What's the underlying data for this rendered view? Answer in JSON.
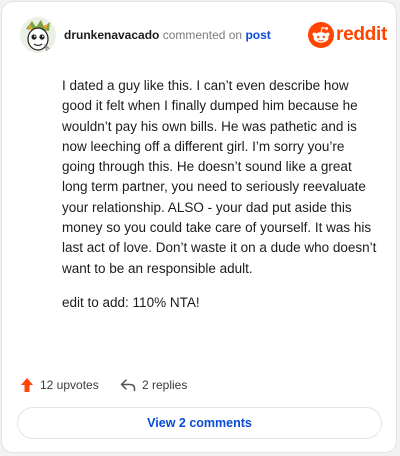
{
  "comment": {
    "username": "drunkenavacado",
    "commented_on": "commented on",
    "post_link": "post",
    "paragraphs": [
      "I dated a guy like this. I can’t even describe how good it felt when I finally dumped him because he wouldn’t pay his own bills. He was pathetic and is now leeching off a different girl. I’m sorry you’re going through this. He doesn’t sound like a great long term partner, you need to seriously reevaluate your relationship. ALSO - your dad put aside this money so you could take care of yourself. It was his last act of love. Don’t waste it on a dude who doesn’t want to be an responsible adult.",
      "edit to add: 110% NTA!"
    ]
  },
  "brand": {
    "name": "reddit",
    "color": "#ff4500"
  },
  "actions": {
    "upvotes_label": "12 upvotes",
    "replies_label": "2 replies"
  },
  "view_comments_label": "View 2 comments",
  "colors": {
    "accent_link": "#0a4bd6",
    "upvote": "#ff4500"
  }
}
